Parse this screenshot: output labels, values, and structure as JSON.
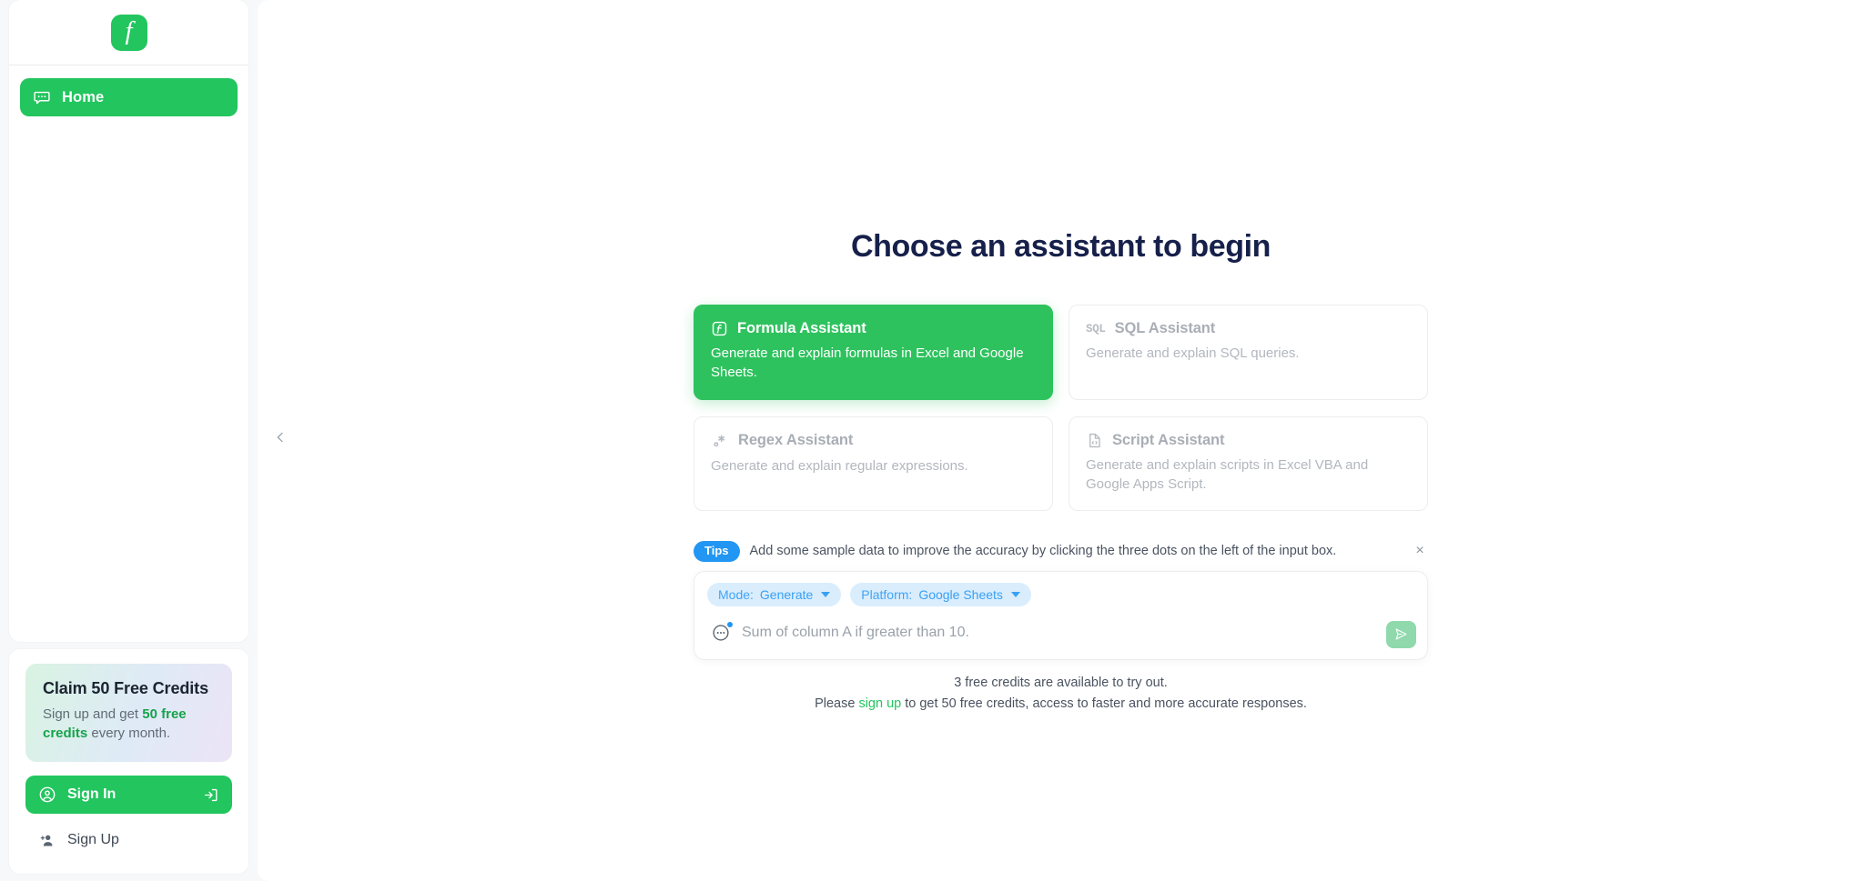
{
  "sidebar": {
    "logo_glyph": "f",
    "nav": [
      {
        "label": "Home",
        "icon": "chat-bubble-icon"
      }
    ],
    "promo": {
      "title": "Claim 50 Free Credits",
      "text_before": "Sign up and get ",
      "text_highlight": "50 free credits",
      "text_after": " every month."
    },
    "sign_in_label": "Sign In",
    "sign_up_label": "Sign Up"
  },
  "main": {
    "title": "Choose an assistant to begin",
    "cards": [
      {
        "title": "Formula Assistant",
        "desc": "Generate and explain formulas in Excel and Google Sheets.",
        "icon": "formula-f-box-icon",
        "selected": true
      },
      {
        "title": "SQL Assistant",
        "desc": "Generate and explain SQL queries.",
        "icon": "sql-text-icon",
        "selected": false
      },
      {
        "title": "Regex Assistant",
        "desc": "Generate and explain regular expressions.",
        "icon": "regex-asterisk-icon",
        "selected": false
      },
      {
        "title": "Script Assistant",
        "desc": "Generate and explain scripts in Excel VBA and Google Apps Script.",
        "icon": "script-document-icon",
        "selected": false
      }
    ],
    "tips": {
      "badge": "Tips",
      "text": "Add some sample data to improve the accuracy by clicking the three dots on the left of the input box.",
      "close_glyph": "×"
    },
    "composer": {
      "chips": [
        {
          "key": "Mode:",
          "value": "Generate"
        },
        {
          "key": "Platform:",
          "value": "Google Sheets"
        }
      ],
      "input_value": "",
      "input_placeholder": "Sum of column A if greater than 10.",
      "send_icon": "send-plane-icon",
      "dots_icon": "three-dots-circle-icon"
    },
    "footnotes": {
      "line1": "3 free credits are available to try out.",
      "line2_before": "Please ",
      "line2_link": "sign up",
      "line2_after": " to get 50 free credits, access to faster and more accurate responses."
    },
    "collapse_icon": "chevron-left-icon"
  },
  "colors": {
    "brand_green": "#22c55e",
    "card_selected": "#2ec25e",
    "tips_blue": "#2196f3",
    "chip_blue": "#3aa0f3",
    "title_navy": "#16204a"
  }
}
